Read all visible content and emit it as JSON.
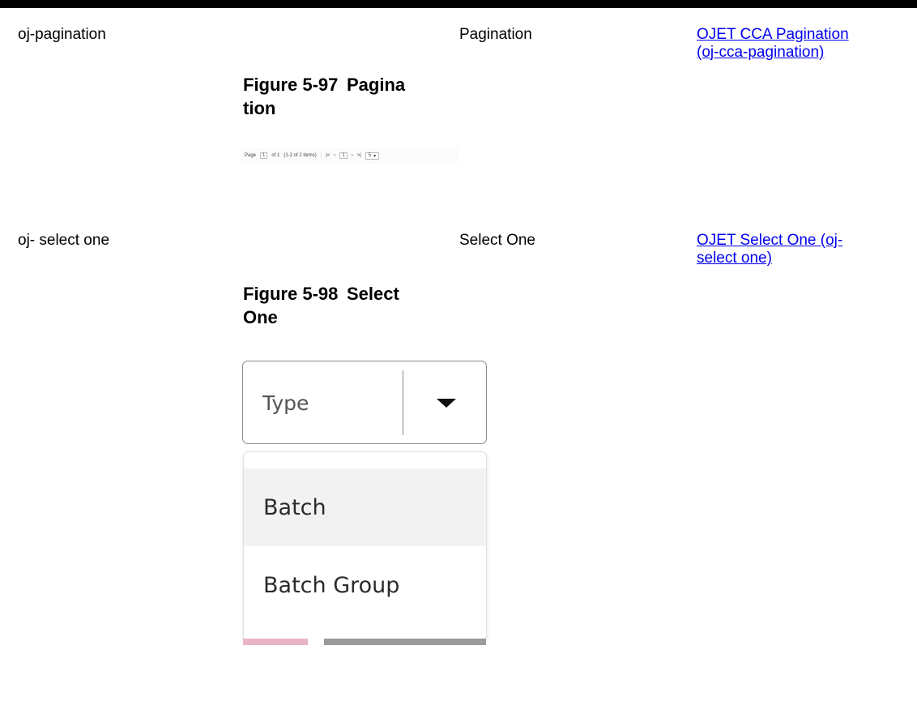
{
  "rows": [
    {
      "name": "oj-pagination",
      "component": "Pagination",
      "link_line1": "OJET CCA Pagination",
      "link_line2": "(oj-cca-pagination)",
      "figure_num": "Figure 5-97",
      "figure_title_line1": "Pagina",
      "figure_title_line2": "tion"
    },
    {
      "name": "oj- select one",
      "component": "Select One",
      "link_line1": "OJET Select One (oj-",
      "link_line2": "select one)",
      "figure_num": "Figure 5-98",
      "figure_title_line1": "Select",
      "figure_title_line2": "One"
    }
  ],
  "pagination": {
    "page_label": "Page",
    "page_value": "1",
    "of_label": "of 1",
    "items_label": "(1-2 of 2 items)",
    "first_icon": "first-page-icon",
    "prev_icon": "previous-page-icon",
    "current_page": "1",
    "next_icon": "next-page-icon",
    "last_icon": "last-page-icon",
    "page_size": "5"
  },
  "select_one": {
    "placeholder": "Type",
    "options": [
      "Batch",
      "Batch Group"
    ],
    "highlighted_option": "Batch"
  },
  "colors": {
    "link": "#0000ee",
    "highlight": "#f2f2f2",
    "border": "#8a8a8a"
  }
}
